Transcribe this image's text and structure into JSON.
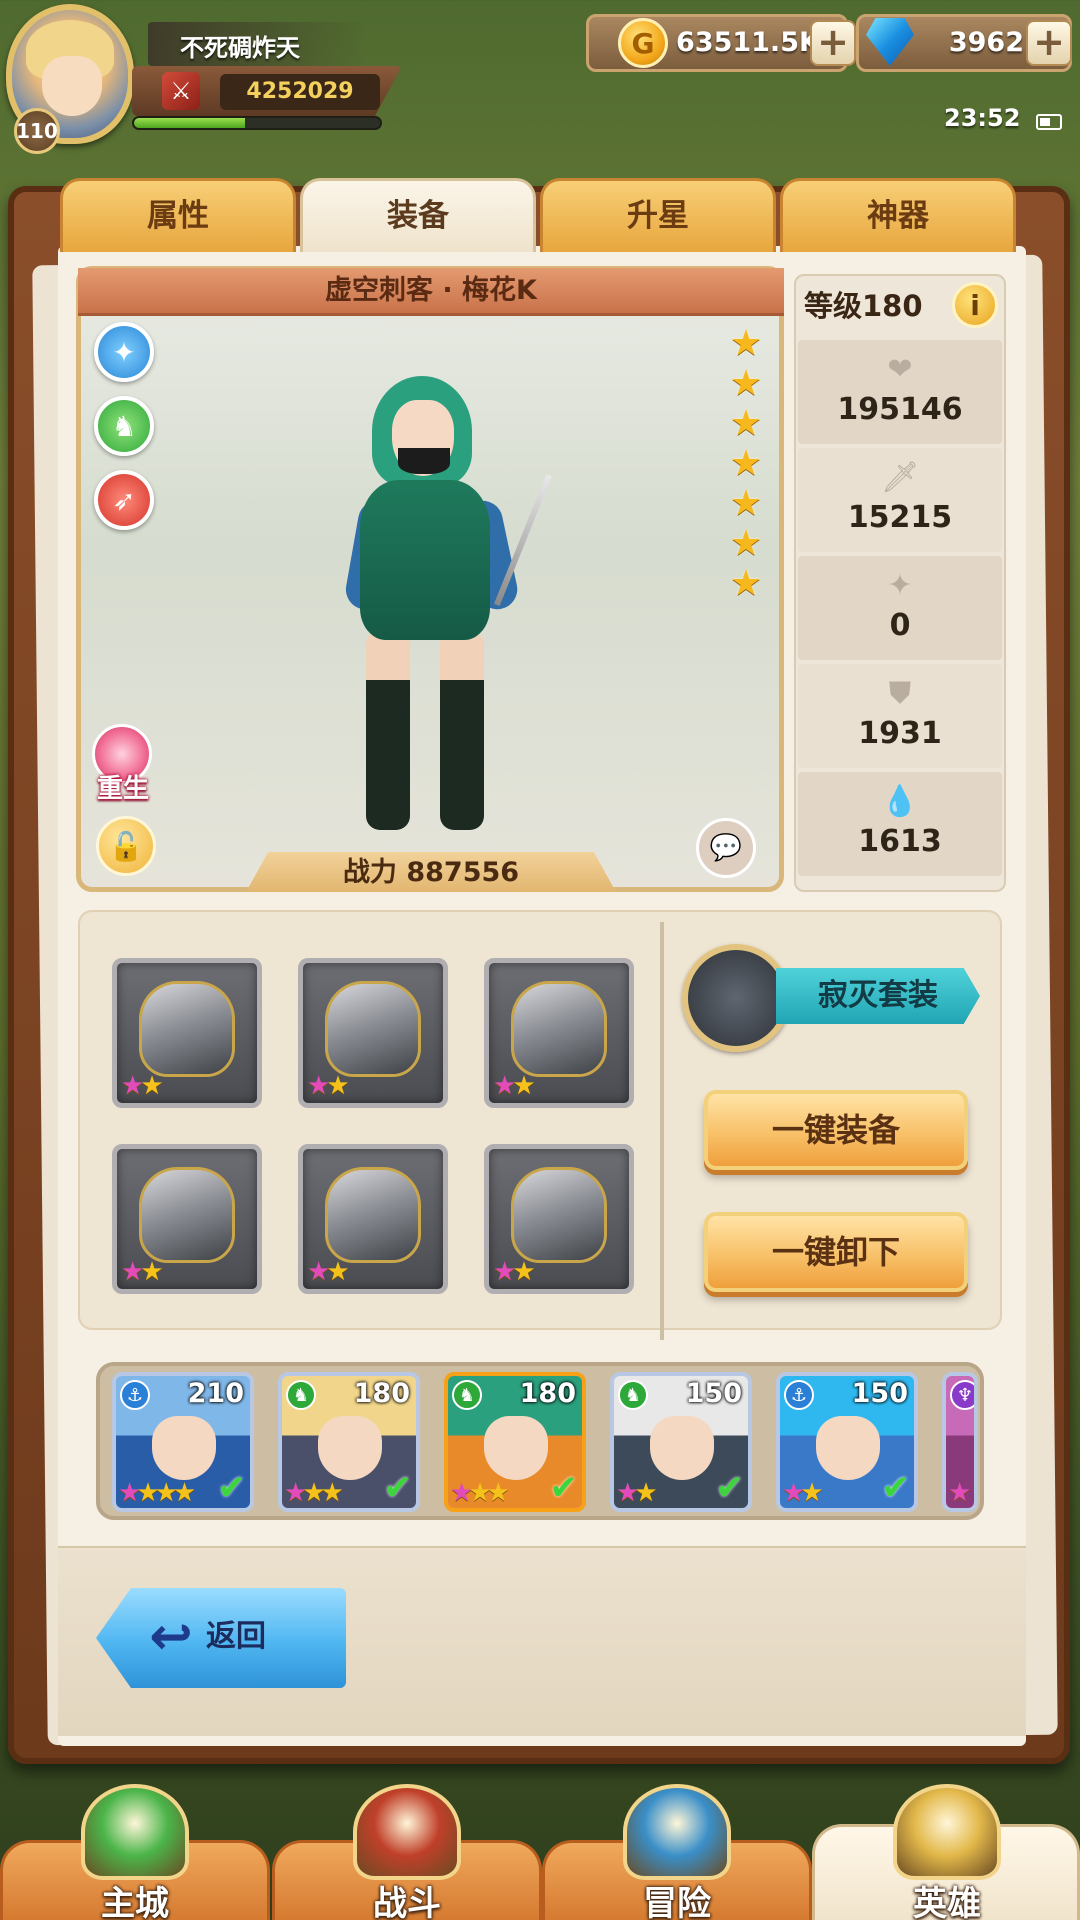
{
  "player": {
    "name": "不死碉炸天",
    "level": "110",
    "power": "4252029",
    "exp_fraction": 0.45
  },
  "currency": {
    "gold": "63511.5K",
    "gems": "3962",
    "plus": "+"
  },
  "status": {
    "time": "23:52"
  },
  "tabs": [
    "属性",
    "装备",
    "升星",
    "神器"
  ],
  "active_tab": "装备",
  "hero": {
    "name": "虚空刺客 · 梅花K",
    "level_label": "等级180",
    "info_symbol": "i",
    "stars": 7,
    "star_symbol": "★",
    "combat_power": "战力 887556",
    "rebirth_label": "重生",
    "stats": [
      {
        "icon": "heart-icon",
        "symbol": "❤",
        "value": "195146"
      },
      {
        "icon": "sword-icon",
        "symbol": "🗡",
        "value": "15215"
      },
      {
        "icon": "crit-icon",
        "symbol": "✦",
        "value": "0"
      },
      {
        "icon": "shield-icon",
        "symbol": "⛊",
        "value": "1931"
      },
      {
        "icon": "drop-icon",
        "symbol": "💧",
        "value": "1613"
      }
    ]
  },
  "equipment": {
    "slots": [
      {
        "name": "helmet",
        "stars": 2
      },
      {
        "name": "axe",
        "stars": 2
      },
      {
        "name": "armor",
        "stars": 2
      },
      {
        "name": "shield",
        "stars": 2
      },
      {
        "name": "boots",
        "stars": 2
      },
      {
        "name": "ring",
        "stars": 2
      }
    ],
    "set_name": "寂灭套装",
    "equip_all": "一键装备",
    "unequip_all": "一键卸下"
  },
  "hero_list": [
    {
      "level": "210",
      "faction": "anchor",
      "stars": 4,
      "checked": true,
      "selected": false,
      "hair": "#7fb7e8",
      "bg": "#2a5da8"
    },
    {
      "level": "180",
      "faction": "beast",
      "stars": 3,
      "checked": true,
      "selected": false,
      "hair": "#f0d58a",
      "bg": "#4a4f6a"
    },
    {
      "level": "180",
      "faction": "beast",
      "stars": 3,
      "checked": true,
      "selected": true,
      "hair": "#2aa07e",
      "bg": "#e88a2a"
    },
    {
      "level": "150",
      "faction": "beast",
      "stars": 2,
      "checked": true,
      "selected": false,
      "hair": "#e8e8e8",
      "bg": "#3c4a5a"
    },
    {
      "level": "150",
      "faction": "anchor",
      "stars": 2,
      "checked": true,
      "selected": false,
      "hair": "#2fb8f0",
      "bg": "#3a78c8"
    },
    {
      "level": "",
      "faction": "void",
      "stars": 1,
      "checked": false,
      "selected": false,
      "hair": "#c76ab8",
      "bg": "#8a3a7a"
    }
  ],
  "back_button": {
    "label": "返回",
    "arrow": "↩"
  },
  "bottom_nav": [
    {
      "label": "主城",
      "emblem": "#4bb54a"
    },
    {
      "label": "战斗",
      "emblem": "#c0402a"
    },
    {
      "label": "冒险",
      "emblem": "#3a8fc8"
    },
    {
      "label": "英雄",
      "emblem": "#e2b84a"
    }
  ],
  "active_nav": "英雄",
  "colors": {
    "tab_active": "#f3e9d6",
    "tab_inactive": "#f1b455",
    "set_label": "#32bcc6",
    "action_button": "#f8c169",
    "back_button": "#4fb6f1"
  }
}
